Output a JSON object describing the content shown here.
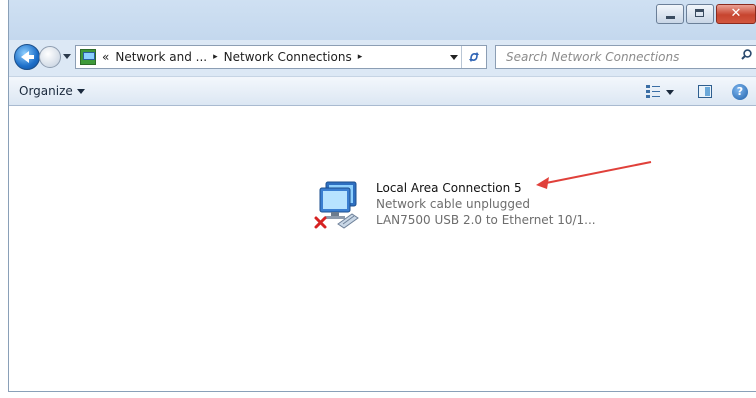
{
  "window": {
    "caption": {
      "close_glyph": "✕"
    }
  },
  "address_bar": {
    "overflow": "«",
    "crumbs": [
      "Network and ...",
      "Network Connections"
    ],
    "separator": "▸"
  },
  "search": {
    "placeholder": "Search Network Connections"
  },
  "toolbar": {
    "organize_label": "Organize"
  },
  "connection": {
    "name": "Local Area Connection 5",
    "status": "Network cable unplugged",
    "device": "LAN7500 USB 2.0 to Ethernet 10/1..."
  },
  "colors": {
    "arrow": "#e0403a",
    "error_x": "#d62222",
    "frame": "#dce8f5"
  },
  "icons": [
    "back-icon",
    "forward-icon",
    "refresh-icon",
    "search-icon",
    "views-icon",
    "preview-pane-icon",
    "help-icon",
    "network-adapter-icon",
    "disconnected-x-icon"
  ]
}
